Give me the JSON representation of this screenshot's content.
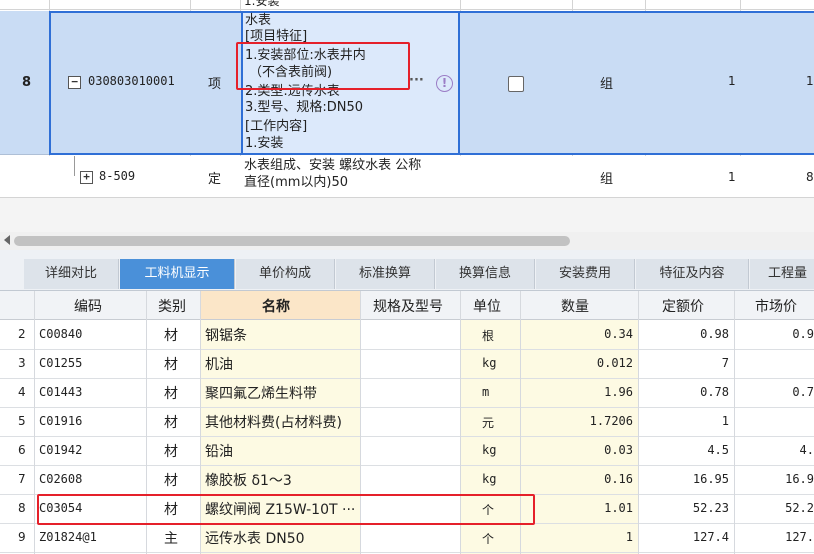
{
  "top_grid": {
    "row_partial": {
      "content": "1.安装"
    },
    "row8": {
      "num": "8",
      "code": "030803010001",
      "type": "项",
      "content_lines": [
        "水表",
        "[项目特征]",
        "1.安装部位:水表井内",
        "（不含表前阀)",
        "2.类型:远传水表",
        "3.型号、规格:DN50",
        "[工作内容]",
        "1.安装"
      ],
      "ellipsis": "···",
      "unit": "组",
      "qty": "1",
      "trailing": "1"
    },
    "sub_row": {
      "code": "8-509",
      "type": "定",
      "content_lines": [
        "水表组成、安装 螺纹水表 公称",
        "直径(mm以内)50"
      ],
      "unit": "组",
      "qty": "1",
      "trailing": "8"
    }
  },
  "tabs": [
    "详细对比",
    "工料机显示",
    "单价构成",
    "标准换算",
    "换算信息",
    "安装费用",
    "特征及内容",
    "工程量"
  ],
  "active_tab": 1,
  "table": {
    "headers": [
      "编码",
      "类别",
      "名称",
      "规格及型号",
      "单位",
      "数量",
      "定额价",
      "市场价"
    ],
    "rows": [
      {
        "n": "2",
        "code": "C00840",
        "cat": "材",
        "name": "钢锯条",
        "unit": "根",
        "qty": "0.34",
        "price": "0.98",
        "market": "0.9"
      },
      {
        "n": "3",
        "code": "C01255",
        "cat": "材",
        "name": "机油",
        "unit": "kg",
        "qty": "0.012",
        "price": "7",
        "market": ""
      },
      {
        "n": "4",
        "code": "C01443",
        "cat": "材",
        "name": "聚四氟乙烯生料带",
        "unit": "m",
        "qty": "1.96",
        "price": "0.78",
        "market": "0.7"
      },
      {
        "n": "5",
        "code": "C01916",
        "cat": "材",
        "name": "其他材料费(占材料费)",
        "unit": "元",
        "qty": "1.7206",
        "price": "1",
        "market": ""
      },
      {
        "n": "6",
        "code": "C01942",
        "cat": "材",
        "name": "铅油",
        "unit": "kg",
        "qty": "0.03",
        "price": "4.5",
        "market": "4."
      },
      {
        "n": "7",
        "code": "C02608",
        "cat": "材",
        "name": "橡胶板 δ1～3",
        "unit": "kg",
        "qty": "0.16",
        "price": "16.95",
        "market": "16.9"
      },
      {
        "n": "8",
        "code": "C03054",
        "cat": "材",
        "name": "螺纹闸阀 Z15W-10T ···",
        "unit": "个",
        "qty": "1.01",
        "price": "52.23",
        "market": "52.2"
      },
      {
        "n": "9",
        "code": "Z01824@1",
        "cat": "主",
        "name": "远传水表 DN50",
        "unit": "个",
        "qty": "1",
        "price": "127.4",
        "market": "127."
      }
    ]
  },
  "colors": {
    "accent": "#4a90d9",
    "highlight_red": "#e5202a",
    "selected_row": "#c9dcf4",
    "yellow_cell": "#fdfae3"
  }
}
